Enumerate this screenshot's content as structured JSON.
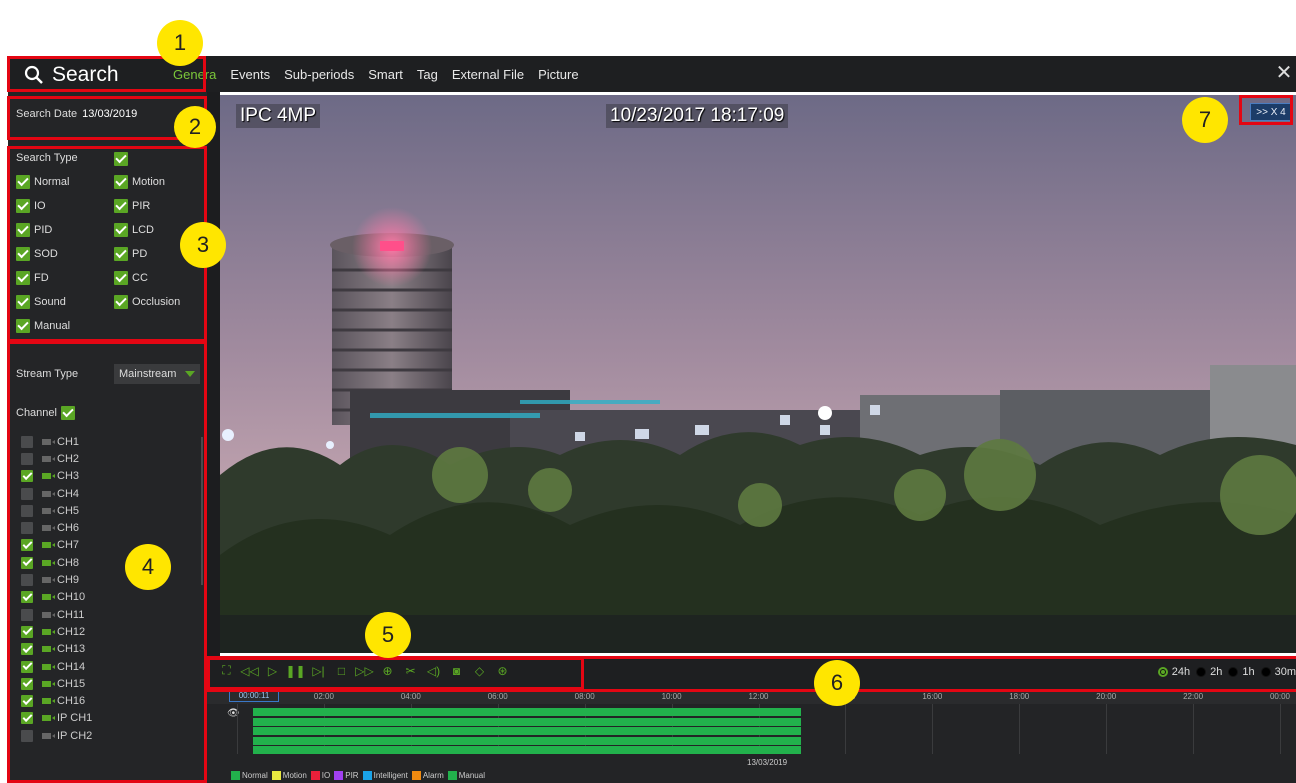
{
  "header": {
    "search_label": "Search",
    "tabs": [
      {
        "label": "Genera",
        "active": true
      },
      {
        "label": "Events"
      },
      {
        "label": "Sub-periods"
      },
      {
        "label": "Smart"
      },
      {
        "label": "Tag"
      },
      {
        "label": "External File"
      },
      {
        "label": "Picture"
      }
    ],
    "close_glyph": "✕"
  },
  "sidebar": {
    "search_date_label": "Search Date",
    "search_date_value": "13/03/2019",
    "search_type_label": "Search Type",
    "search_type_all": true,
    "search_types": [
      {
        "label": "Normal",
        "checked": true
      },
      {
        "label": "Motion",
        "checked": true
      },
      {
        "label": "IO",
        "checked": true
      },
      {
        "label": "PIR",
        "checked": true
      },
      {
        "label": "PID",
        "checked": true
      },
      {
        "label": "LCD",
        "checked": true
      },
      {
        "label": "SOD",
        "checked": true
      },
      {
        "label": "PD",
        "checked": true
      },
      {
        "label": "FD",
        "checked": true
      },
      {
        "label": "CC",
        "checked": true
      },
      {
        "label": "Sound",
        "checked": true
      },
      {
        "label": "Occlusion",
        "checked": true
      },
      {
        "label": "Manual",
        "checked": true
      }
    ],
    "stream_type_label": "Stream Type",
    "stream_type_value": "Mainstream",
    "channel_label": "Channel",
    "channel_all": true,
    "channels": [
      {
        "label": "CH1",
        "checked": false
      },
      {
        "label": "CH2",
        "checked": false
      },
      {
        "label": "CH3",
        "checked": true
      },
      {
        "label": "CH4",
        "checked": false
      },
      {
        "label": "CH5",
        "checked": false
      },
      {
        "label": "CH6",
        "checked": false
      },
      {
        "label": "CH7",
        "checked": true
      },
      {
        "label": "CH8",
        "checked": true
      },
      {
        "label": "CH9",
        "checked": false
      },
      {
        "label": "CH10",
        "checked": true
      },
      {
        "label": "CH11",
        "checked": false
      },
      {
        "label": "CH12",
        "checked": true
      },
      {
        "label": "CH13",
        "checked": true
      },
      {
        "label": "CH14",
        "checked": true
      },
      {
        "label": "CH15",
        "checked": true
      },
      {
        "label": "CH16",
        "checked": true
      },
      {
        "label": "IP CH1",
        "checked": true
      },
      {
        "label": "IP CH2",
        "checked": false
      }
    ]
  },
  "video": {
    "camera_name": "IPC 4MP",
    "timestamp": "10/23/2017 18:17:09",
    "speed": ">> X 4"
  },
  "controls": {
    "icons": [
      "fullscreen-icon",
      "rewind-icon",
      "play-forward-icon",
      "pause-icon",
      "step-frame-icon",
      "stop-icon",
      "fast-forward-icon",
      "zoom-icon",
      "clip-icon",
      "volume-icon",
      "snapshot-icon",
      "tag-icon",
      "add-tag-icon"
    ],
    "glyphs": [
      "⛶",
      "◁◁",
      "▷",
      "❚❚",
      "▷|",
      "□",
      "▷▷",
      "⊕",
      "✂",
      "◁)",
      "◙",
      "◇",
      "⊛"
    ],
    "zoom_options": [
      {
        "label": "24h",
        "selected": true
      },
      {
        "label": "2h",
        "selected": false
      },
      {
        "label": "1h",
        "selected": false
      },
      {
        "label": "30m",
        "selected": false
      }
    ]
  },
  "timeline": {
    "cursor_time": "00:00:11",
    "ticks": [
      "02:00",
      "04:00",
      "06:00",
      "08:00",
      "10:00",
      "12:00",
      "14:00",
      "16:00",
      "18:00",
      "20:00",
      "22:00",
      "00:00"
    ],
    "date": "13/03/2019",
    "eye_glyph": "👁",
    "recorded_until_hour": 12.6,
    "legend": [
      {
        "label": "Normal",
        "color": "#22b14c"
      },
      {
        "label": "Motion",
        "color": "#e8e840"
      },
      {
        "label": "IO",
        "color": "#e8203a"
      },
      {
        "label": "PIR",
        "color": "#a040f0"
      },
      {
        "label": "Intelligent",
        "color": "#1aa3e8"
      },
      {
        "label": "Alarm",
        "color": "#f08a10"
      },
      {
        "label": "Manual",
        "color": "#22b14c"
      }
    ]
  },
  "annotations": {
    "markers": [
      "1",
      "2",
      "3",
      "4",
      "5",
      "6",
      "7"
    ],
    "box_color": "#e40613",
    "marker_color": "#ffe600"
  }
}
